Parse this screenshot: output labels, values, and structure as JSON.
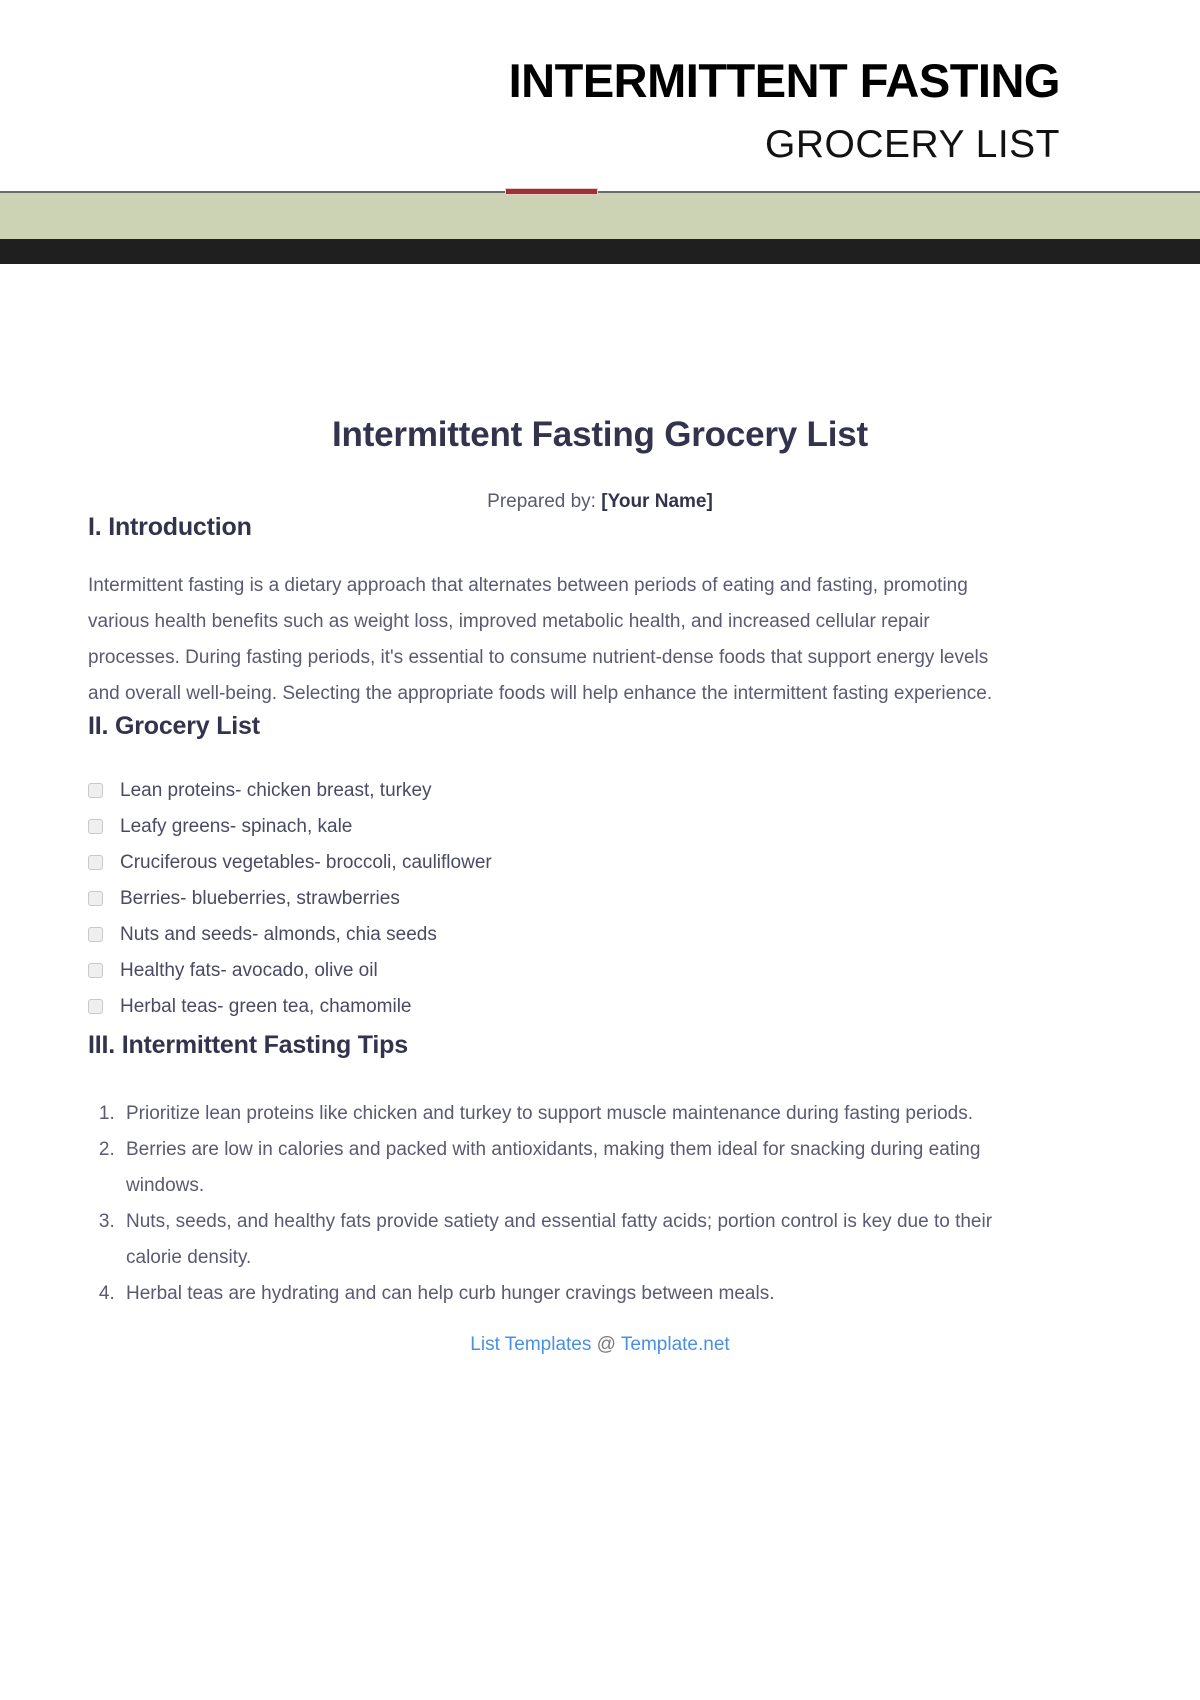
{
  "masthead": {
    "title": "INTERMITTENT FASTING",
    "subtitle": "GROCERY LIST",
    "accent_color": "#9e3232",
    "band_sage_color": "#ccd2b4",
    "band_dark_color": "#1f1f1f"
  },
  "document": {
    "title": "Intermittent Fasting Grocery List",
    "prepared_label": "Prepared by:",
    "prepared_value": "[Your Name]"
  },
  "sections": {
    "introduction": {
      "heading": "I. Introduction",
      "body": "Intermittent fasting is a dietary approach that alternates between periods of eating and fasting, promoting various health benefits such as weight loss, improved metabolic health, and increased cellular repair processes. During fasting periods, it's essential to consume nutrient-dense foods that support energy levels and overall well-being. Selecting the appropriate foods will help enhance the intermittent fasting experience."
    },
    "grocery": {
      "heading": "II. Grocery List",
      "items": [
        "Lean proteins- chicken breast, turkey",
        "Leafy greens- spinach, kale",
        "Cruciferous vegetables- broccoli, cauliflower",
        "Berries- blueberries, strawberries",
        "Nuts and seeds- almonds, chia seeds",
        "Healthy fats- avocado, olive oil",
        "Herbal teas- green tea, chamomile"
      ]
    },
    "tips": {
      "heading": "III. Intermittent Fasting Tips",
      "items": [
        "Prioritize lean proteins like chicken and turkey to support muscle maintenance during fasting periods.",
        "Berries are low in calories and packed with antioxidants, making them ideal for snacking during eating windows.",
        "Nuts, seeds, and healthy fats provide satiety and essential fatty acids; portion control is key due to their calorie density.",
        "Herbal teas are hydrating and can help curb hunger cravings between meals."
      ]
    }
  },
  "footer": {
    "link_prefix": "List Templates",
    "at": "@",
    "link_suffix": "Template.net",
    "link_color": "#4a90e2"
  }
}
